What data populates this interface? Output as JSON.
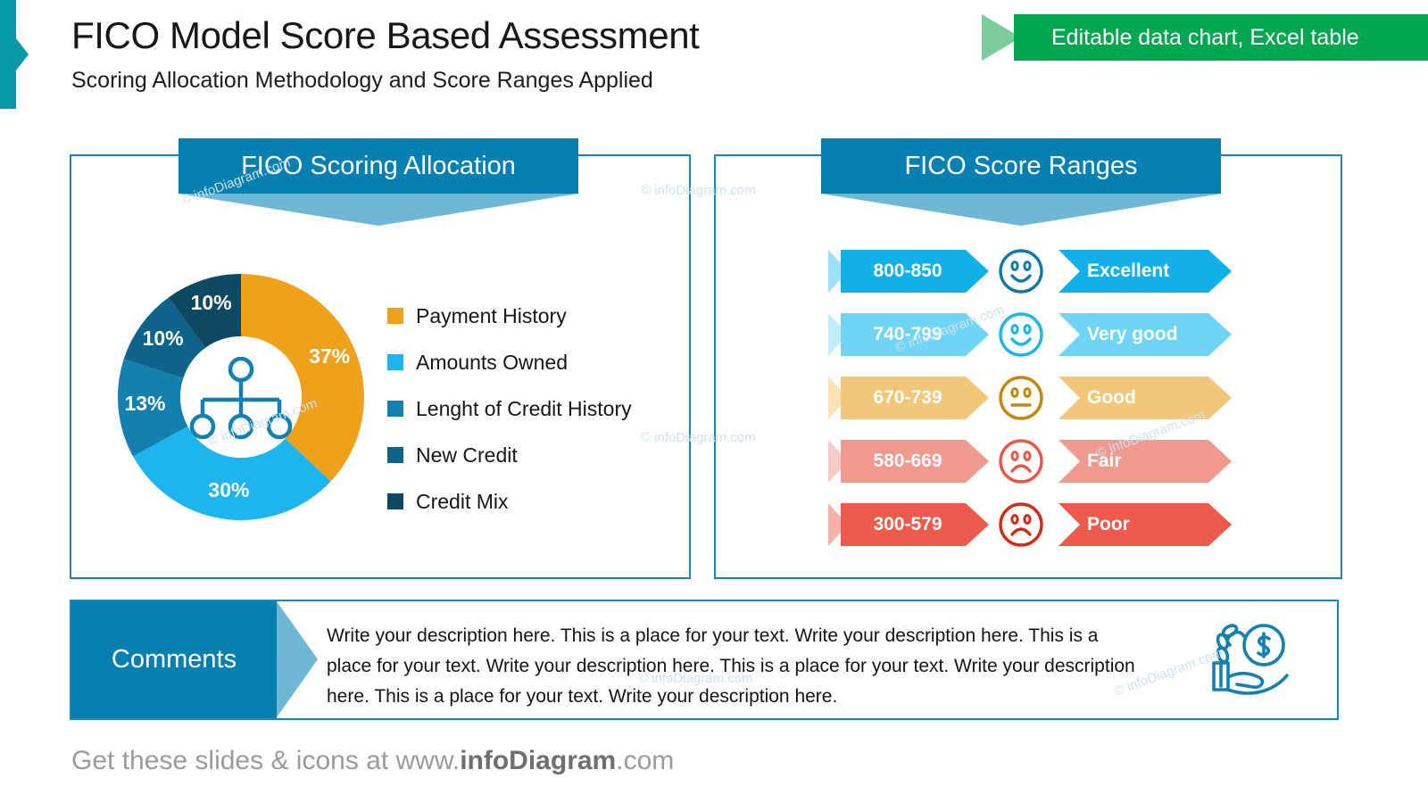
{
  "header": {
    "title": "FICO Model Score Based Assessment",
    "subtitle": "Scoring Allocation Methodology and Score Ranges Applied",
    "ribbon_label": "Editable data chart, Excel table",
    "ribbon_color": "#00A650",
    "accent_color": "#089AA8"
  },
  "panels": {
    "left_header": "FICO Scoring Allocation",
    "right_header": "FICO Score Ranges",
    "header_color": "#0580B0",
    "header_tail_color": "#6FB8D5",
    "border_color": "#1B86B8"
  },
  "chart_data": {
    "type": "pie",
    "title": "FICO Scoring Allocation",
    "subtype": "donut",
    "categories": [
      "Payment History",
      "Amounts Owned",
      "Lenght of Credit History",
      "New Credit",
      "Credit Mix"
    ],
    "values": [
      37,
      30,
      13,
      10,
      10
    ],
    "value_labels": [
      "37%",
      "30%",
      "13%",
      "10%",
      "10%"
    ],
    "colors": [
      "#EFA11C",
      "#1EB5EE",
      "#1380AE",
      "#0E6488",
      "#0D4A62"
    ],
    "units": "percent",
    "legend_position": "right",
    "center_icon": "hierarchy-icon",
    "start_angle_deg": 0,
    "grid": false
  },
  "score_ranges": {
    "rows": [
      {
        "range": "800-850",
        "label": "Excellent",
        "color": "#12B0E8",
        "light": "#9FE0F7",
        "face": "happy",
        "face_color": "#1279A8"
      },
      {
        "range": "740-799",
        "label": "Very good",
        "color": "#6FD5F5",
        "light": "#C2ECFA",
        "face": "happy",
        "face_color": "#1EB5EE"
      },
      {
        "range": "670-739",
        "label": "Good",
        "color": "#F3C77A",
        "light": "#F9E2B6",
        "face": "neutral",
        "face_color": "#C6860E"
      },
      {
        "range": "580-669",
        "label": "Fair",
        "color": "#F0998F",
        "light": "#F8CCC6",
        "face": "sad",
        "face_color": "#E8584A"
      },
      {
        "range": "300-579",
        "label": "Poor",
        "color": "#EC5B4B",
        "light": "#F6B1A8",
        "face": "sad",
        "face_color": "#D32B17"
      }
    ]
  },
  "comments": {
    "label": "Comments",
    "text": "Write your description here. This is a place for your text. Write your description here. This is a place for your text. Write your description here. This is a place for your text. Write your description here. This is a place for your text. Write your description here.",
    "icon": "hand-money-icon",
    "icon_color": "#1380AE"
  },
  "footer": {
    "prefix": "Get these slides & icons at www.",
    "brand": "infoDiagram",
    "suffix": ".com"
  },
  "watermarks": {
    "text": "© infoDiagram.com"
  }
}
